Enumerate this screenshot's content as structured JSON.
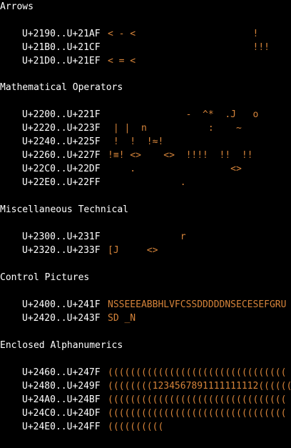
{
  "accent_color": "#d6843a",
  "text_color": "#ffffff",
  "background_color": "#000000",
  "sections": [
    {
      "title": "Arrows",
      "rows": [
        {
          "range": "U+2190..U+21AF",
          "glyphs": "< - <                     !"
        },
        {
          "range": "U+21B0..U+21CF",
          "glyphs": "                          !!!"
        },
        {
          "range": "U+21D0..U+21EF",
          "glyphs": "< = <"
        }
      ]
    },
    {
      "title": "Mathematical Operators",
      "rows": [
        {
          "range": "U+2200..U+221F",
          "glyphs": "              -  ^*  .J   o"
        },
        {
          "range": "U+2220..U+223F",
          "glyphs": " | |  n           :    ~"
        },
        {
          "range": "U+2240..U+225F",
          "glyphs": " !  !  !≈!"
        },
        {
          "range": "U+2260..U+227F",
          "glyphs": "!≡! <>    <>  !!!!  !!  !!"
        },
        {
          "range": "U+22C0..U+22DF",
          "glyphs": "    .                 <>"
        },
        {
          "range": "U+22E0..U+22FF",
          "glyphs": "             ."
        }
      ]
    },
    {
      "title": "Miscellaneous Technical",
      "rows": [
        {
          "range": "U+2300..U+231F",
          "glyphs": "             r"
        },
        {
          "range": "U+2320..U+233F",
          "glyphs": "[J     <>"
        }
      ]
    },
    {
      "title": "Control Pictures",
      "rows": [
        {
          "range": "U+2400..U+241F",
          "glyphs": "NSSEEEABBHLVFCSSDDDDDNSECESEFGRU"
        },
        {
          "range": "U+2420..U+243F",
          "glyphs": "SD _N"
        }
      ]
    },
    {
      "title": "Enclosed Alphanumerics",
      "rows": [
        {
          "range": "U+2460..U+247F",
          "glyphs": "(((((((((((((((((((((((((((((((("
        },
        {
          "range": "U+2480..U+249F",
          "glyphs": "((((((((1234567891111111112(((((("
        },
        {
          "range": "U+24A0..U+24BF",
          "glyphs": "(((((((((((((((((((((((((((((((("
        },
        {
          "range": "U+24C0..U+24DF",
          "glyphs": "(((((((((((((((((((((((((((((((("
        },
        {
          "range": "U+24E0..U+24FF",
          "glyphs": "(((((((((("
        }
      ]
    }
  ]
}
